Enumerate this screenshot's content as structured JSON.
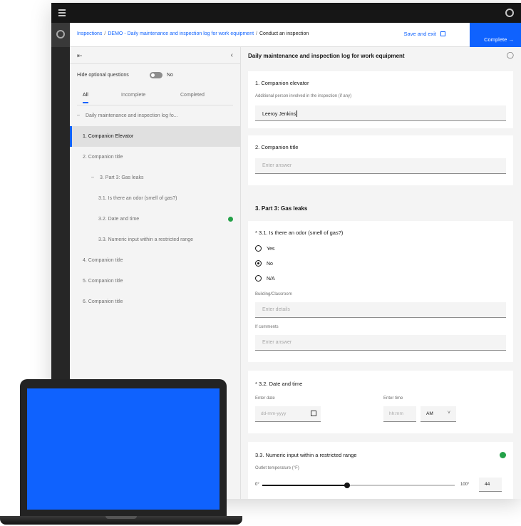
{
  "header": {
    "breadcrumb": [
      "Inspections",
      "DEMO - Daily maintenance and inspection log for work equipment",
      "Conduct an inspection"
    ],
    "save_exit_label": "Save and exit",
    "complete_label": "Complete"
  },
  "left_panel": {
    "toggle_label": "Hide optional questions",
    "toggle_value": "No",
    "filter_tabs": [
      "All",
      "Incomplete",
      "Completed"
    ],
    "nav_items": [
      {
        "label": "Daily maintenance and inspection log fo...",
        "prefix": "–",
        "level": 0,
        "active": false,
        "done": false
      },
      {
        "label": "1. Companion Elevator",
        "prefix": "",
        "level": 1,
        "active": true,
        "done": false
      },
      {
        "label": "2. Companion title",
        "prefix": "",
        "level": 1,
        "active": false,
        "done": false
      },
      {
        "label": "3. Part 3: Gas leaks",
        "prefix": "–",
        "level": 2,
        "active": false,
        "done": false
      },
      {
        "label": "3.1. Is there an odor (smell of gas?)",
        "prefix": "",
        "level": 3,
        "active": false,
        "done": false
      },
      {
        "label": "3.2. Date and time",
        "prefix": "",
        "level": 3,
        "active": false,
        "done": true
      },
      {
        "label": "3.3. Numeric input within a restricted range",
        "prefix": "",
        "level": 3,
        "active": false,
        "done": false
      },
      {
        "label": "4. Companion title",
        "prefix": "",
        "level": 1,
        "active": false,
        "done": false
      },
      {
        "label": "5. Companion title",
        "prefix": "",
        "level": 1,
        "active": false,
        "done": false
      },
      {
        "label": "6. Companion title",
        "prefix": "",
        "level": 1,
        "active": false,
        "done": false
      }
    ]
  },
  "content": {
    "title": "Daily maintenance and inspection log for work equipment",
    "q1": {
      "title": "1. Companion elevator",
      "hint": "Additional person involved in the inspection (if any)",
      "value": "Leeroy Jenkins"
    },
    "q2": {
      "title": "2. Companion title",
      "placeholder": "Enter answer"
    },
    "section3": {
      "title": "3. Part 3: Gas leaks"
    },
    "q31": {
      "title": "* 3.1. Is there an odor (smell of gas?)",
      "options": [
        "Yes",
        "No",
        "N/A"
      ],
      "selected": "No",
      "building_label": "Building/Classroom",
      "building_placeholder": "Enter details",
      "comments_label": "If comments",
      "comments_placeholder": "Enter answer"
    },
    "q32": {
      "title": "* 3.2. Date and time",
      "date_label": "Enter date",
      "date_placeholder": "dd-mm-yyyy",
      "time_label": "Enter time",
      "time_placeholder": "hh:mm",
      "ampm": "AM"
    },
    "q33": {
      "title": "3.3. Numeric input within a restricted range",
      "slider_label": "Outlet temperature (°F)",
      "min_label": "0°",
      "max_label": "100°",
      "value": "44",
      "fraction": 0.44
    }
  },
  "colors": {
    "accent": "#0f62fe",
    "success": "#24a148",
    "topbar": "#161616",
    "laptop_screen": "#0f62fe"
  },
  "icons": [
    "menu-icon",
    "user-icon",
    "collapse-icon",
    "chevron-left-icon",
    "close-icon",
    "calendar-icon",
    "chevron-down-icon",
    "save-icon"
  ]
}
